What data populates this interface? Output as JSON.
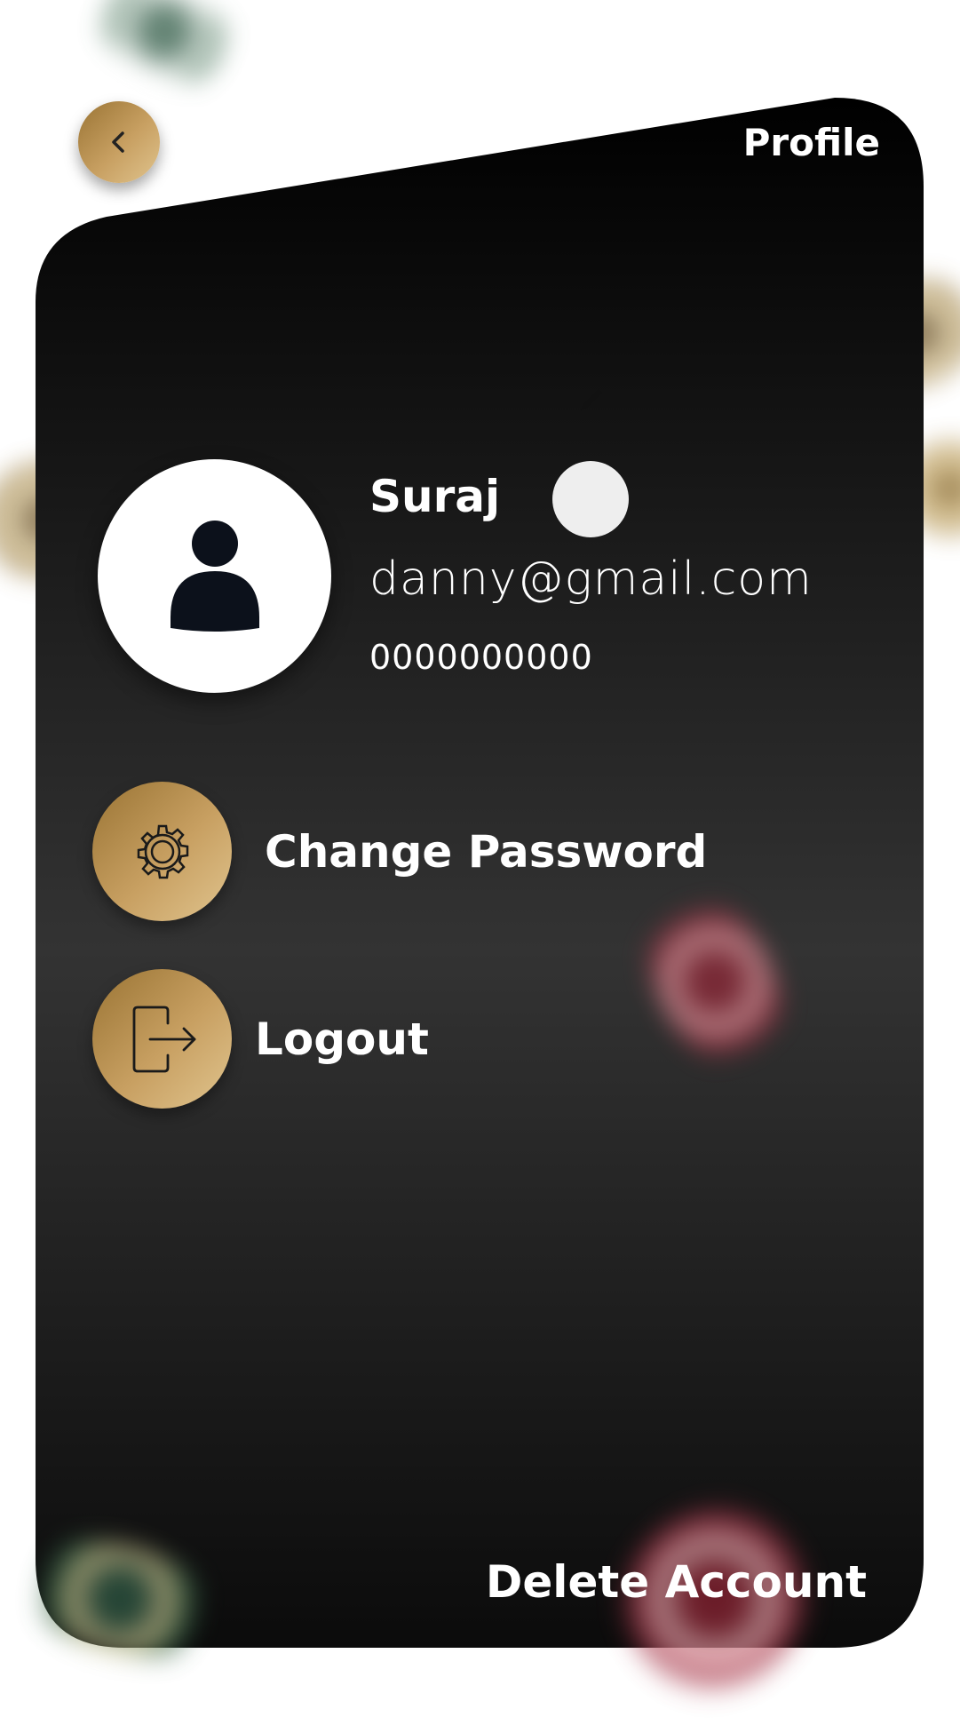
{
  "header": {
    "title": "Profile",
    "back_icon": "chevron-left-icon"
  },
  "profile": {
    "name": "Suraj",
    "email": "danny@gmail.com",
    "phone": "0000000000",
    "avatar_icon": "person-icon",
    "edit_icon": "pencil-icon"
  },
  "menu": {
    "items": [
      {
        "label": "Change Password",
        "icon": "gear-icon"
      },
      {
        "label": "Logout",
        "icon": "logout-icon"
      }
    ]
  },
  "footer": {
    "delete_label": "Delete Account"
  },
  "colors": {
    "card_dark": "#0b0b0b",
    "card_mid": "#333333",
    "gold_dark": "#9a7434",
    "gold_light": "#e0c48e",
    "text": "#ffffff"
  }
}
